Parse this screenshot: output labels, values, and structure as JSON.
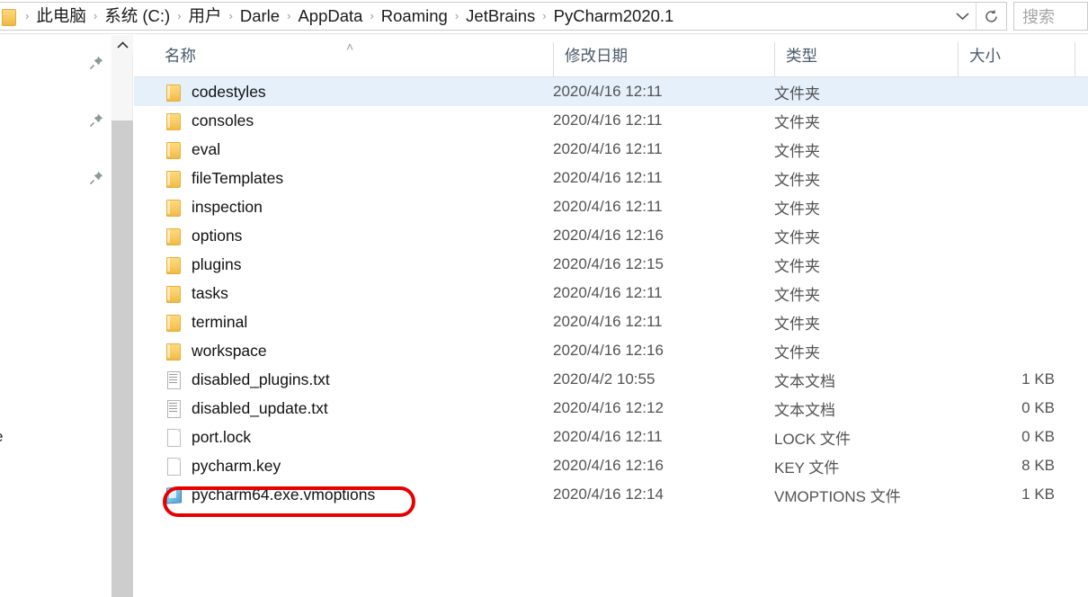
{
  "addressbar": {
    "folder_icon": "folder-icon",
    "breadcrumbs": [
      "此电脑",
      "系统 (C:)",
      "用户",
      "Darle",
      "AppData",
      "Roaming",
      "JetBrains",
      "PyCharm2020.1"
    ],
    "separator": "›",
    "dropdown_icon": "chevron-down-icon",
    "refresh_icon": "refresh-icon",
    "search_placeholder": "搜索"
  },
  "navpane": {
    "pin_icon": "pin-icon",
    "pin_count": 3,
    "clipped_label": "e"
  },
  "scrollbar": {
    "up_arrow_icon": "chevron-up-icon"
  },
  "filelist": {
    "sort_indicator": "˄",
    "columns": [
      {
        "key": "name",
        "label": "名称"
      },
      {
        "key": "date",
        "label": "修改日期"
      },
      {
        "key": "type",
        "label": "类型"
      },
      {
        "key": "size",
        "label": "大小"
      }
    ],
    "rows": [
      {
        "icon": "folder-icon",
        "name": "codestyles",
        "date": "2020/4/16 12:11",
        "type": "文件夹",
        "size": "",
        "selected": true
      },
      {
        "icon": "folder-icon",
        "name": "consoles",
        "date": "2020/4/16 12:11",
        "type": "文件夹",
        "size": "",
        "selected": false
      },
      {
        "icon": "folder-icon",
        "name": "eval",
        "date": "2020/4/16 12:11",
        "type": "文件夹",
        "size": "",
        "selected": false
      },
      {
        "icon": "folder-icon",
        "name": "fileTemplates",
        "date": "2020/4/16 12:11",
        "type": "文件夹",
        "size": "",
        "selected": false
      },
      {
        "icon": "folder-icon",
        "name": "inspection",
        "date": "2020/4/16 12:11",
        "type": "文件夹",
        "size": "",
        "selected": false
      },
      {
        "icon": "folder-icon",
        "name": "options",
        "date": "2020/4/16 12:16",
        "type": "文件夹",
        "size": "",
        "selected": false
      },
      {
        "icon": "folder-icon",
        "name": "plugins",
        "date": "2020/4/16 12:15",
        "type": "文件夹",
        "size": "",
        "selected": false
      },
      {
        "icon": "folder-icon",
        "name": "tasks",
        "date": "2020/4/16 12:11",
        "type": "文件夹",
        "size": "",
        "selected": false
      },
      {
        "icon": "folder-icon",
        "name": "terminal",
        "date": "2020/4/16 12:11",
        "type": "文件夹",
        "size": "",
        "selected": false
      },
      {
        "icon": "folder-icon",
        "name": "workspace",
        "date": "2020/4/16 12:16",
        "type": "文件夹",
        "size": "",
        "selected": false
      },
      {
        "icon": "text-file-icon",
        "name": "disabled_plugins.txt",
        "date": "2020/4/2 10:55",
        "type": "文本文档",
        "size": "1 KB",
        "selected": false
      },
      {
        "icon": "text-file-icon",
        "name": "disabled_update.txt",
        "date": "2020/4/16 12:12",
        "type": "文本文档",
        "size": "0 KB",
        "selected": false
      },
      {
        "icon": "blank-file-icon",
        "name": "port.lock",
        "date": "2020/4/16 12:11",
        "type": "LOCK 文件",
        "size": "0 KB",
        "selected": false
      },
      {
        "icon": "blank-file-icon",
        "name": "pycharm.key",
        "date": "2020/4/16 12:16",
        "type": "KEY 文件",
        "size": "8 KB",
        "selected": false
      },
      {
        "icon": "vmoptions-file-icon",
        "name": "pycharm64.exe.vmoptions",
        "date": "2020/4/16 12:14",
        "type": "VMOPTIONS 文件",
        "size": "1 KB",
        "selected": false
      }
    ]
  },
  "annotation": {
    "target": "pycharm64.exe.vmoptions",
    "shape": "rounded-rectangle",
    "color": "#e60000"
  }
}
